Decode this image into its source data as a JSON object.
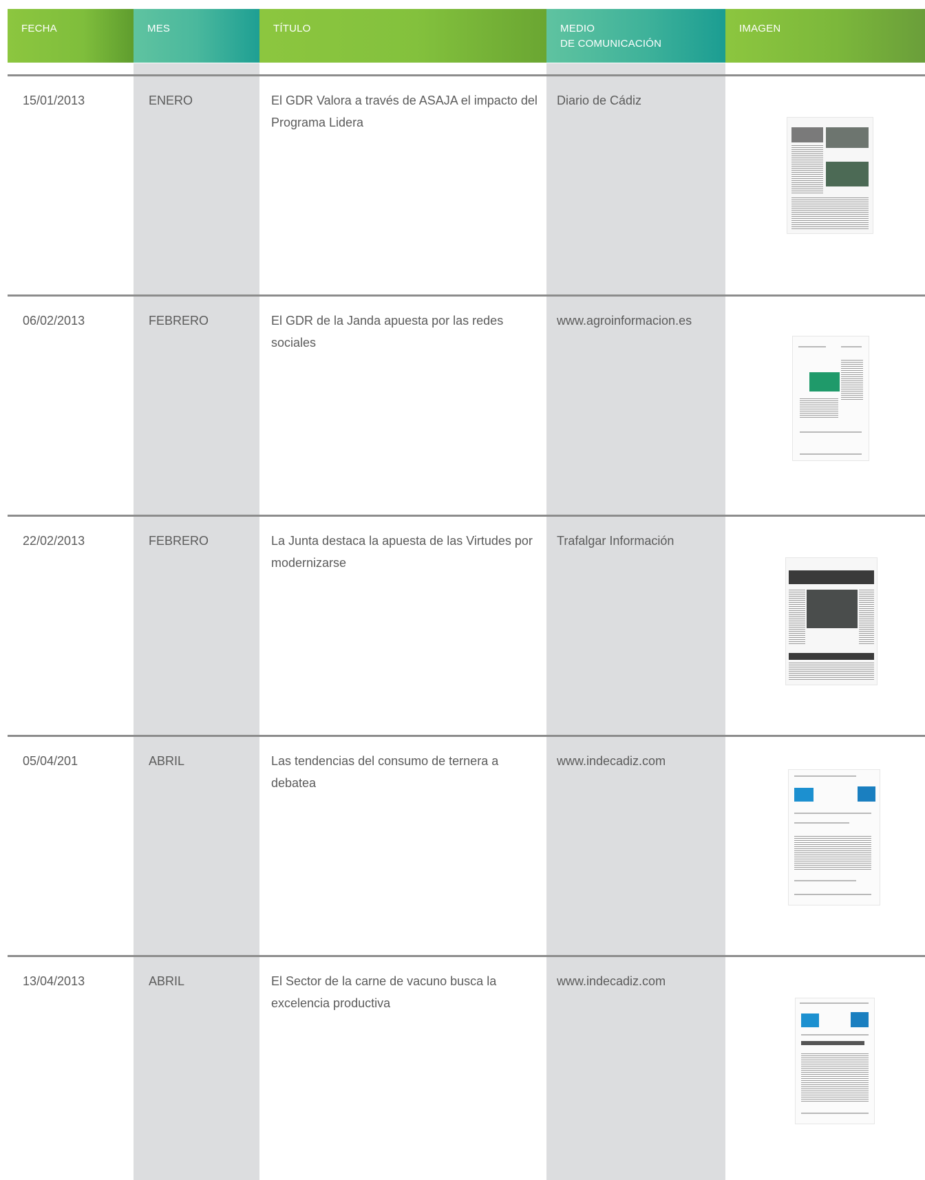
{
  "header": {
    "fecha": "FECHA",
    "mes": "MES",
    "titulo": "TÍTULO",
    "medio_line1": "MEDIO",
    "medio_line2": "DE COMUNICACIÓN",
    "imagen": "IMAGEN"
  },
  "rows": [
    {
      "fecha": "15/01/2013",
      "mes": "ENERO",
      "titulo": "El GDR Valora a través de ASAJA el impacto del Programa Lidera",
      "medio": "Diario de Cádiz",
      "thumbnail": "newspaper-clipping"
    },
    {
      "fecha": "06/02/2013",
      "mes": "FEBRERO",
      "titulo": "El GDR de la Janda apuesta por las redes sociales",
      "medio": "www.agroinformacion.es",
      "thumbnail": "webpage-screenshot"
    },
    {
      "fecha": "22/02/2013",
      "mes": "FEBRERO",
      "titulo": "La Junta destaca la apuesta de las Virtudes por modernizarse",
      "medio": "Trafalgar Información",
      "thumbnail": "newspaper-clipping"
    },
    {
      "fecha": "05/04/201",
      "mes": "ABRIL",
      "titulo": "Las tendencias del consumo de ternera a debatea",
      "medio": "www.indecadiz.com",
      "thumbnail": "webpage-screenshot"
    },
    {
      "fecha": "13/04/2013",
      "mes": "ABRIL",
      "titulo": "El Sector de la carne de vacuno busca la excelencia productiva",
      "medio": "www.indecadiz.com",
      "thumbnail": "webpage-screenshot"
    }
  ],
  "colors": {
    "green": "#8cc63f",
    "teal": "#3fb29a",
    "band_gray": "#dcdddf",
    "rule_gray": "#8c8c8c"
  }
}
